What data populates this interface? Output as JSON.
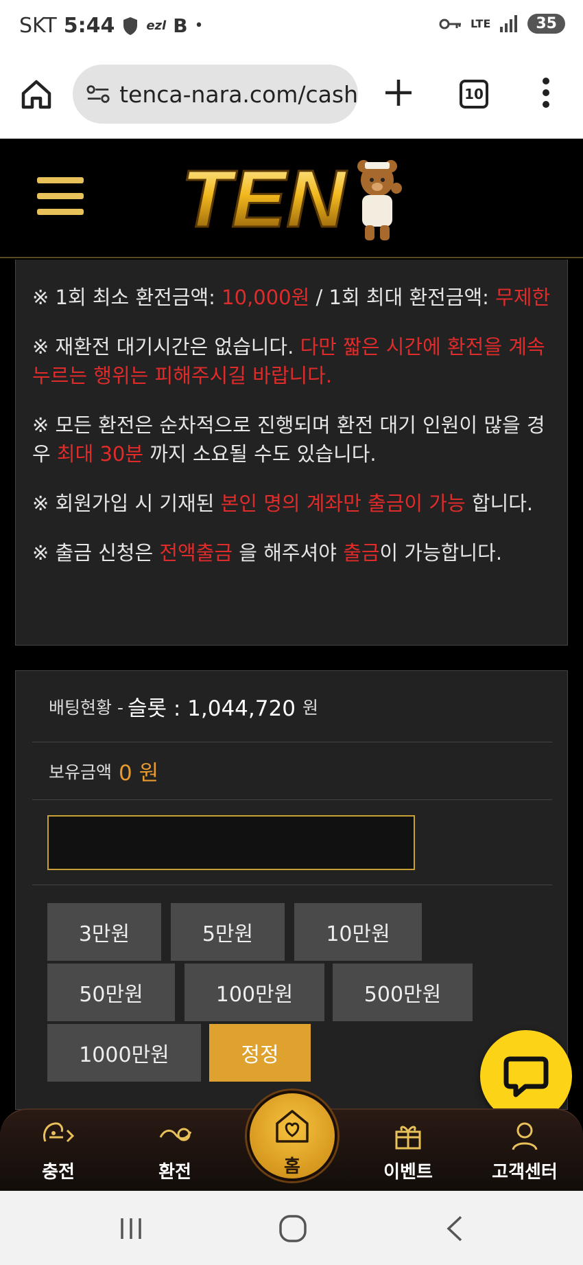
{
  "status_bar": {
    "carrier": "SKT",
    "time": "5:44",
    "network": "LTE",
    "battery": "35"
  },
  "browser": {
    "url": "tenca-nara.com/cash",
    "tab_count": "10"
  },
  "notices": [
    {
      "parts": [
        "※ 1회 최소 환전금액: ",
        "10,000원",
        " / 1회 최대 환전금액: ",
        "무제한"
      ]
    },
    {
      "parts": [
        "※ 재환전 대기시간은 없습니다. ",
        "다만 짧은 시간에 환전을 계속 누르는 행위는 피해주시길 바랍니다."
      ]
    },
    {
      "parts": [
        "※ 모든 환전은 순차적으로 진행되며 환전 대기 인원이 많을 경우 ",
        "최대 30분",
        " 까지 소요될 수도 있습니다."
      ]
    },
    {
      "parts": [
        "※ 회원가입 시 기재된 ",
        "본인 명의 계좌만 출금이 가능",
        " 합니다."
      ]
    },
    {
      "parts": [
        "※ 출금 신청은 ",
        "전액출금",
        " 을 해주셔야 ",
        "출금",
        "이 가능합니다."
      ]
    }
  ],
  "betting": {
    "label": "배팅현황 - ",
    "type": "슬롯 : 1,044,720",
    "unit": "원"
  },
  "balance": {
    "label": "보유금액",
    "amount": "0 원"
  },
  "amount_input": {
    "value": ""
  },
  "amount_buttons": {
    "b1": "3만원",
    "b2": "5만원",
    "b3": "10만원",
    "b4": "50만원",
    "b5": "100만원",
    "b6": "500만원",
    "b7": "1000만원",
    "reset": "정정"
  },
  "bottom_nav": {
    "charge": "충전",
    "exchange": "환전",
    "home": "홈",
    "event": "이벤트",
    "support": "고객센터"
  },
  "colors": {
    "accent_gold": "#e0a22e",
    "warning_red": "#e02b2b",
    "chat_yellow": "#fcd317"
  },
  "icons": [
    "home-icon",
    "site-settings-icon",
    "plus-icon",
    "more-icon",
    "menu-icon",
    "chat-icon",
    "charge-icon",
    "exchange-icon",
    "event-gift-icon",
    "support-icon"
  ]
}
